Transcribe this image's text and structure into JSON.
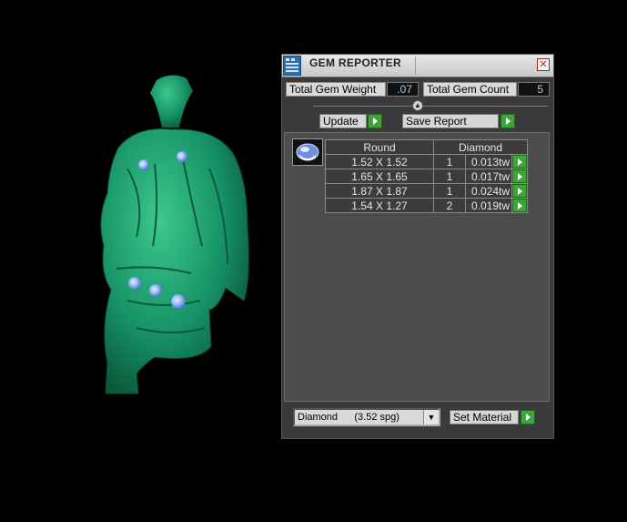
{
  "window": {
    "title": "GEM REPORTER",
    "close_symbol": "✕"
  },
  "summary": {
    "weight_label": "Total Gem Weight",
    "weight_value": ".07",
    "count_label": "Total Gem Count",
    "count_value": "5"
  },
  "actions": {
    "update_label": "Update",
    "save_label": "Save Report"
  },
  "gem_table": {
    "headers": [
      "Round",
      "Diamond"
    ],
    "rows": [
      {
        "size": "1.52 X 1.52",
        "qty": "1",
        "weight": "0.013tw"
      },
      {
        "size": "1.65 X 1.65",
        "qty": "1",
        "weight": "0.017tw"
      },
      {
        "size": "1.87 X 1.87",
        "qty": "1",
        "weight": "0.024tw"
      },
      {
        "size": "1.54 X 1.27",
        "qty": "2",
        "weight": "0.019tw"
      }
    ]
  },
  "material": {
    "selected": "Diamond      (3.52 spg)",
    "set_label": "Set Material"
  },
  "colors": {
    "model": "#1f9a6a",
    "gem": "#8fb4ff",
    "go_button": "#3fa43a"
  }
}
